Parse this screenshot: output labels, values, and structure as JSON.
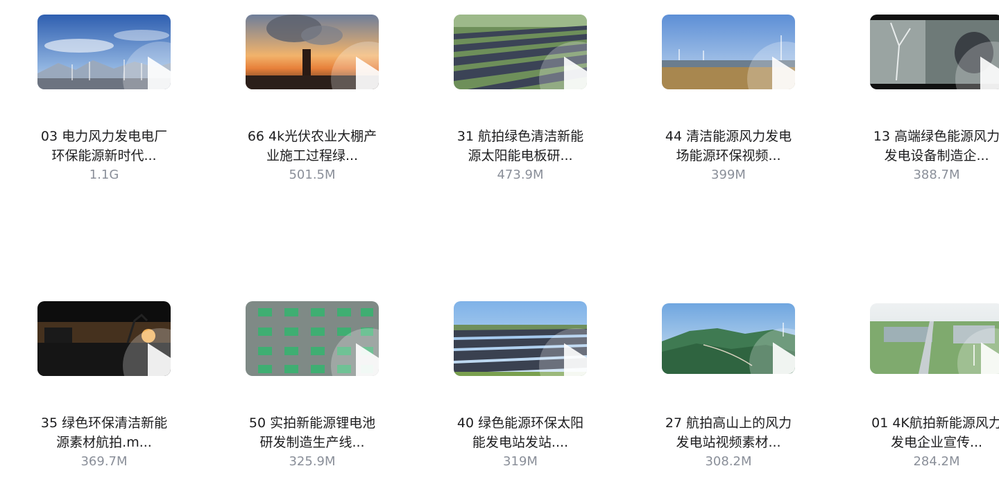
{
  "files": [
    {
      "line1": "03 电力风力发电电厂",
      "line2": "环保能源新时代...",
      "size": "1.1G",
      "scene": "mountain-wind"
    },
    {
      "line1": "66 4k光伏农业大棚产",
      "line2": "业施工过程绿...",
      "size": "501.5M",
      "scene": "sunset-chimney"
    },
    {
      "line1": "31 航拍绿色清洁新能",
      "line2": "源太阳能电板研...",
      "size": "473.9M",
      "scene": "solar-farm"
    },
    {
      "line1": "44 清洁能源风力发电",
      "line2": "场能源环保视频...",
      "size": "399M",
      "scene": "wind-field"
    },
    {
      "line1": "13 高端绿色能源风力",
      "line2": "发电设备制造企...",
      "size": "388.7M",
      "scene": "turbine-model"
    },
    {
      "line1": "35 绿色环保清洁新能",
      "line2": "源素材航拍.m...",
      "size": "369.7M",
      "scene": "excavator-sunset"
    },
    {
      "line1": "50 实拍新能源锂电池",
      "line2": "研发制造生产线...",
      "size": "325.9M",
      "scene": "battery-line"
    },
    {
      "line1": "40 绿色能源环保太阳",
      "line2": "能发电站发站....",
      "size": "319M",
      "scene": "solar-plant"
    },
    {
      "line1": "27 航拍高山上的风力",
      "line2": "发电站视频素材...",
      "size": "308.2M",
      "scene": "mountain-aerial"
    },
    {
      "line1": "01 4K航拍新能源风力",
      "line2": "发电企业宣传...",
      "size": "284.2M",
      "scene": "aerial-town"
    }
  ]
}
